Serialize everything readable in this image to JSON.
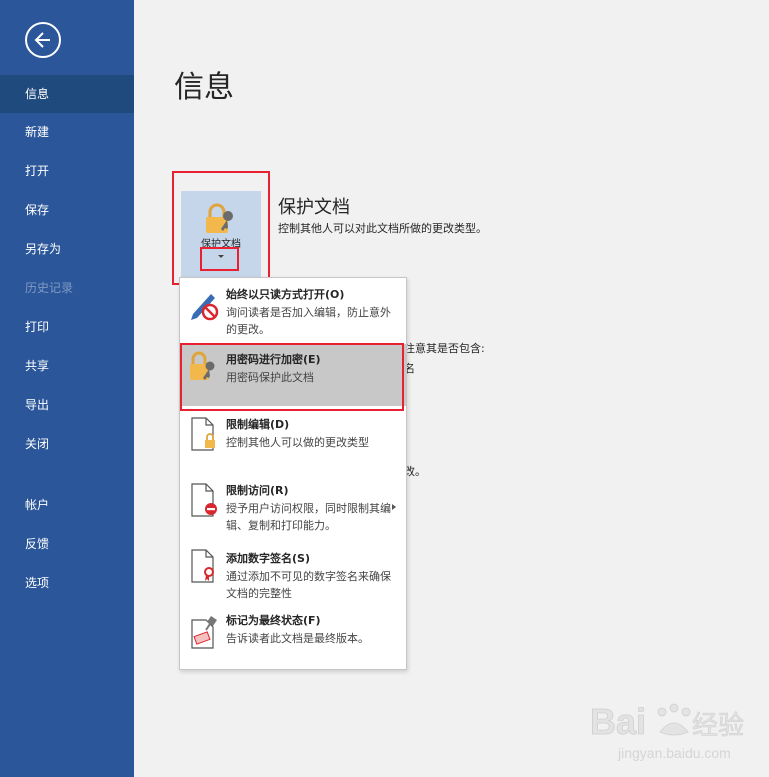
{
  "sidebar": {
    "items": [
      {
        "label": "信息",
        "active": true
      },
      {
        "label": "新建"
      },
      {
        "label": "打开"
      },
      {
        "label": "保存"
      },
      {
        "label": "另存为"
      },
      {
        "label": "历史记录",
        "disabled": true
      },
      {
        "label": "打印"
      },
      {
        "label": "共享"
      },
      {
        "label": "导出"
      },
      {
        "label": "关闭"
      },
      {
        "label": "帐户"
      },
      {
        "label": "反馈"
      },
      {
        "label": "选项"
      }
    ]
  },
  "main": {
    "title": "信息",
    "protect": {
      "button_label": "保护文档",
      "heading": "保护文档",
      "description": "控制其他人可以对此文档所做的更改类型。"
    },
    "background_fragments": {
      "line1": "注意其是否包含:",
      "line2": "名",
      "line3": "改。"
    }
  },
  "menu": {
    "items": [
      {
        "title": "始终以只读方式打开(O)",
        "desc": "询问读者是否加入编辑，防止意外的更改。",
        "icon": "pencil-no-icon"
      },
      {
        "title": "用密码进行加密(E)",
        "desc": "用密码保护此文档",
        "icon": "lock-key-icon"
      },
      {
        "title": "限制编辑(D)",
        "desc": "控制其他人可以做的更改类型",
        "icon": "doc-lock-icon"
      },
      {
        "title": "限制访问(R)",
        "desc": "授予用户访问权限，同时限制其编辑、复制和打印能力。",
        "icon": "doc-restrict-icon"
      },
      {
        "title": "添加数字签名(S)",
        "desc": "通过添加不可见的数字签名来确保文档的完整性",
        "icon": "doc-ribbon-icon"
      },
      {
        "title": "标记为最终状态(F)",
        "desc": "告诉读者此文档是最终版本。",
        "icon": "doc-stamp-icon"
      }
    ]
  },
  "watermark": {
    "brand": "Bai",
    "brand_suffix": "经验",
    "url": "jingyan.baidu.com"
  },
  "colors": {
    "sidebar": "#2b579a",
    "sidebar_active": "#1f4a7d",
    "highlight": "#e8202f",
    "lock": "#f2b84b"
  }
}
